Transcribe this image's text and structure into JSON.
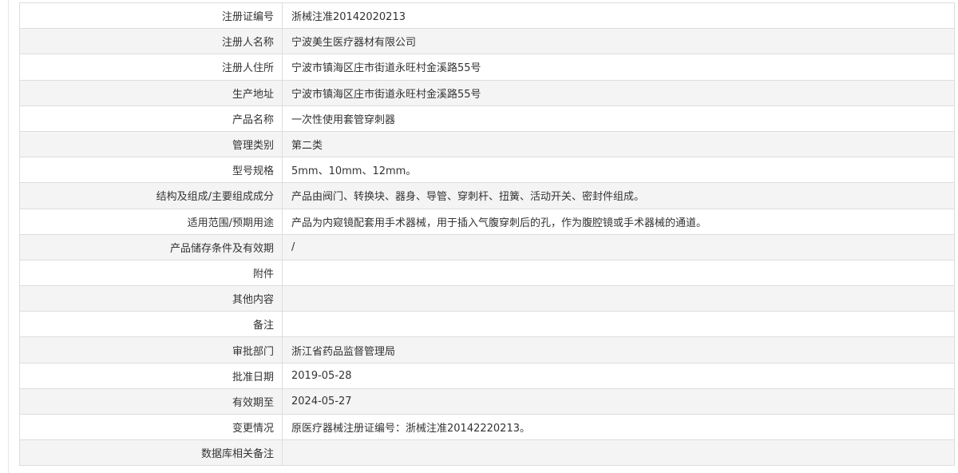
{
  "record": {
    "rows": [
      {
        "label": "注册证编号",
        "value": "浙械注准20142020213"
      },
      {
        "label": "注册人名称",
        "value": "宁波美生医疗器材有限公司"
      },
      {
        "label": "注册人住所",
        "value": "宁波市镇海区庄市街道永旺村金溪路55号"
      },
      {
        "label": "生产地址",
        "value": "宁波市镇海区庄市街道永旺村金溪路55号"
      },
      {
        "label": "产品名称",
        "value": "一次性使用套管穿刺器"
      },
      {
        "label": "管理类别",
        "value": "第二类"
      },
      {
        "label": "型号规格",
        "value": "5mm、10mm、12mm。"
      },
      {
        "label": "结构及组成/主要组成成分",
        "value": "产品由阀门、转换块、器身、导管、穿刺杆、扭簧、活动开关、密封件组成。"
      },
      {
        "label": "适用范围/预期用途",
        "value": "产品为内窥镜配套用手术器械，用于插入气腹穿刺后的孔，作为腹腔镜或手术器械的通道。"
      },
      {
        "label": "产品储存条件及有效期",
        "value": "/"
      },
      {
        "label": "附件",
        "value": ""
      },
      {
        "label": "其他内容",
        "value": ""
      },
      {
        "label": "备注",
        "value": ""
      },
      {
        "label": "审批部门",
        "value": "浙江省药品监督管理局"
      },
      {
        "label": "批准日期",
        "value": "2019-05-28"
      },
      {
        "label": "有效期至",
        "value": "2024-05-27"
      },
      {
        "label": "变更情况",
        "value": "原医疗器械注册证编号：浙械注准20142220213。"
      },
      {
        "label": "数据库相关备注",
        "value": ""
      }
    ]
  },
  "colors": {
    "row_alt_background": "#f4f4f4",
    "border": "#dddddd",
    "text": "#333333"
  }
}
